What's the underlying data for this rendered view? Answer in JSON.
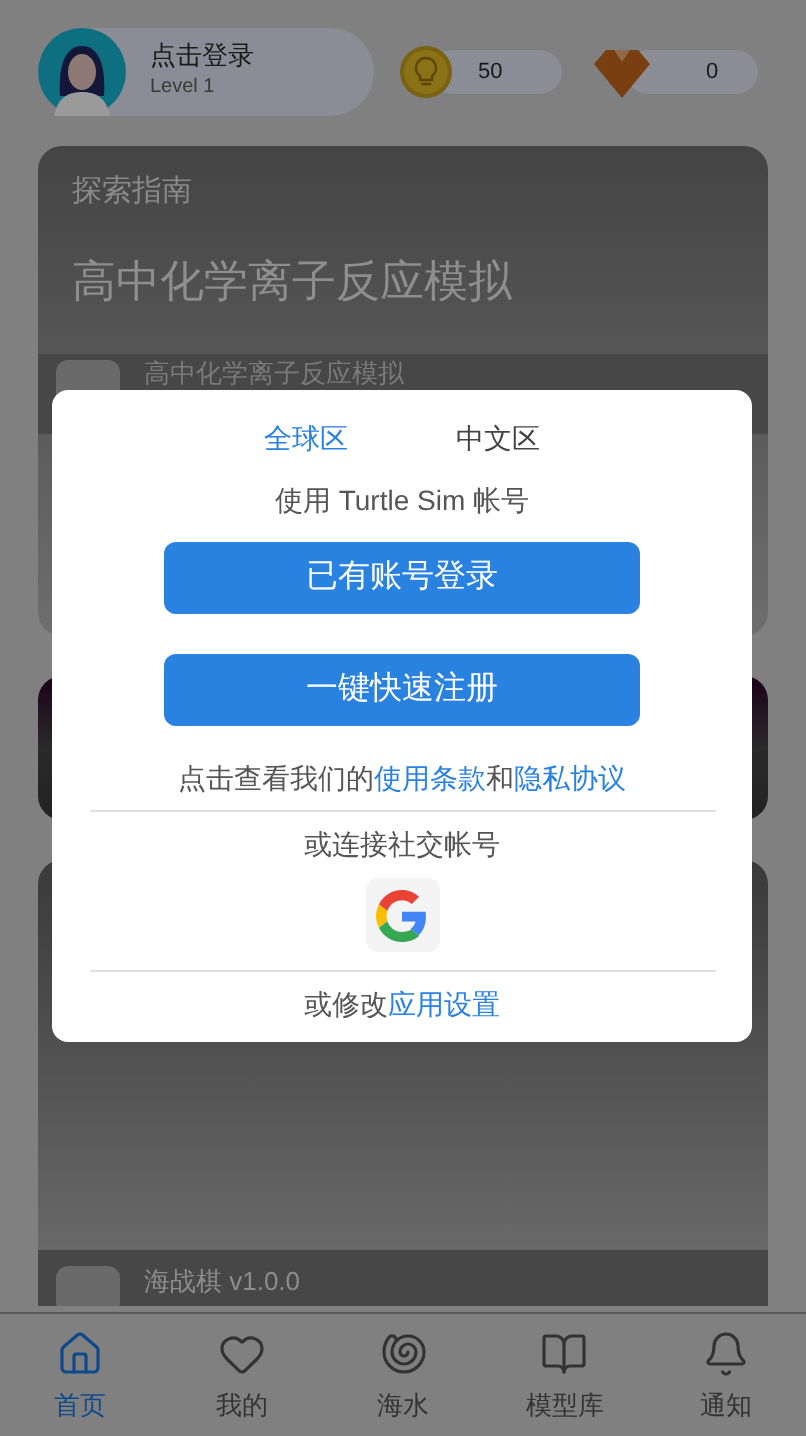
{
  "header": {
    "user_name": "点击登录",
    "user_level": "Level 1",
    "coins": "50",
    "gems": "0"
  },
  "cards": [
    {
      "kind": "guide",
      "category": "探索指南",
      "title": "高中化学离子反应模拟",
      "item": "高中化学离子反应模拟"
    },
    {
      "kind": "banner"
    },
    {
      "kind": "item",
      "item": "海战棋 v1.0.0"
    }
  ],
  "modal": {
    "regions": [
      {
        "label": "全球区",
        "selected": false
      },
      {
        "label": "中文区",
        "selected": true
      }
    ],
    "account_hint": "使用 Turtle Sim 帐号",
    "buttons": [
      "已有账号登录",
      "一键快速注册"
    ],
    "terms_prefix": "点击查看我们的",
    "terms_link": "使用条款",
    "terms_and": "和",
    "privacy_link": "隐私协议",
    "social_label": "或连接社交帐号",
    "settings_prefix": "或修改",
    "settings_link": "应用设置"
  },
  "nav": [
    {
      "kind": "home",
      "label": "首页",
      "selected": true
    },
    {
      "kind": "heart",
      "label": "我的",
      "selected": false
    },
    {
      "kind": "shell",
      "label": "海水",
      "selected": false
    },
    {
      "kind": "book",
      "label": "模型库",
      "selected": false
    },
    {
      "kind": "bell",
      "label": "通知",
      "selected": false
    }
  ]
}
